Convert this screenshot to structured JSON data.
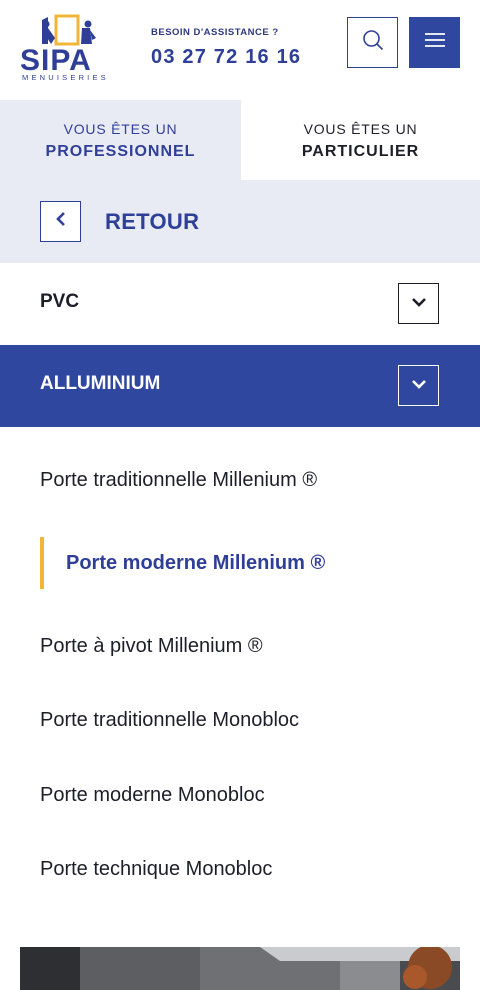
{
  "header": {
    "logo_text": "SIPA",
    "logo_subtext": "MENUISERIES",
    "assist_label": "BESOIN D'ASSISTANCE ?",
    "phone": "03 27 72 16 16",
    "search_icon": "search-icon",
    "menu_icon": "hamburger-icon"
  },
  "audience": {
    "pro_line1": "VOUS ÊTES UN",
    "pro_line2": "PROFESSIONNEL",
    "part_line1": "VOUS ÊTES UN",
    "part_line2": "PARTICULIER"
  },
  "nav": {
    "back_label": "RETOUR",
    "categories": [
      {
        "label": "PVC",
        "expanded": false
      },
      {
        "label": "ALLUMINIUM",
        "expanded": true
      }
    ],
    "sub_items": [
      {
        "label": "Porte traditionnelle Millenium ®",
        "active": false
      },
      {
        "label": "Porte moderne Millenium ®",
        "active": true
      },
      {
        "label": "Porte à pivot Millenium ®",
        "active": false
      },
      {
        "label": "Porte traditionnelle Monobloc",
        "active": false
      },
      {
        "label": "Porte moderne Monobloc",
        "active": false
      },
      {
        "label": "Porte technique Monobloc",
        "active": false
      }
    ]
  },
  "colors": {
    "brand_blue": "#2f479e",
    "text_blue": "#2f3f97",
    "accent_yellow": "#f2b535",
    "panel_bg": "#e8eaf4"
  }
}
